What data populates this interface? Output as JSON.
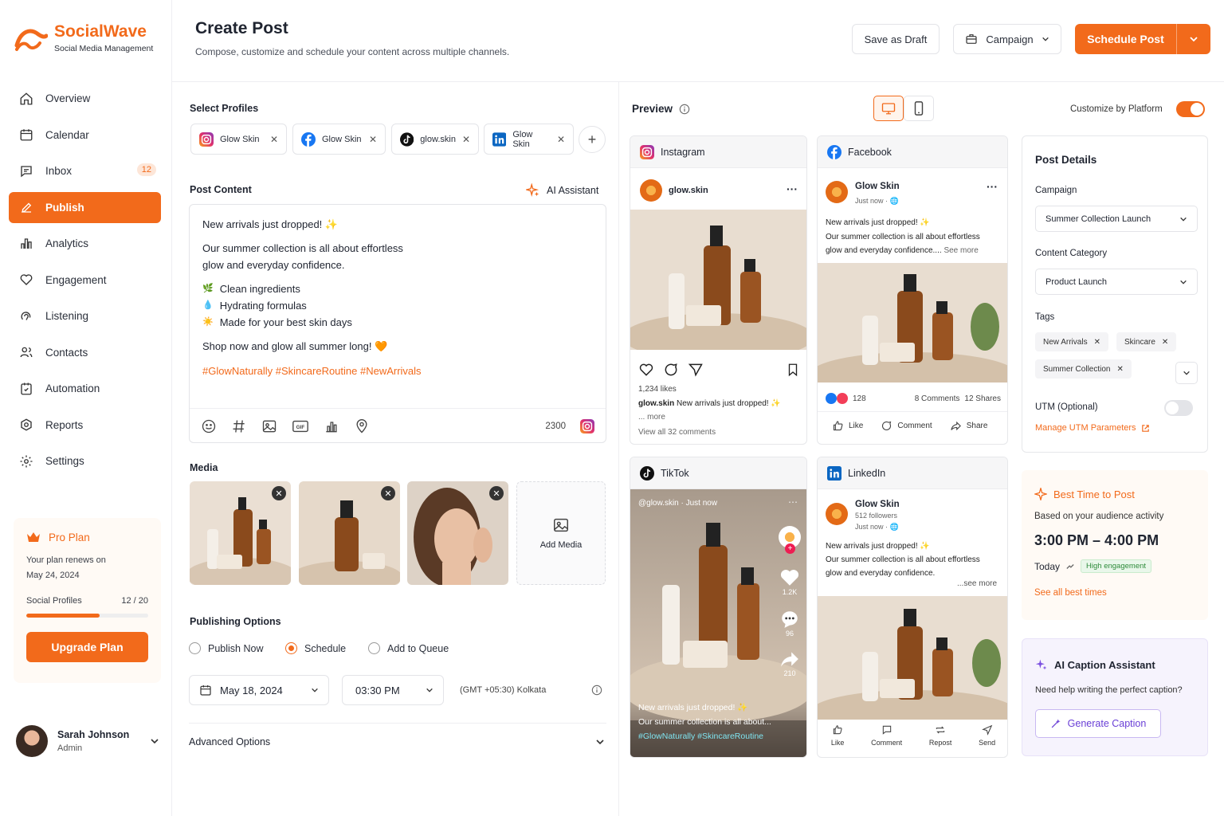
{
  "brand": {
    "name": "SocialWave",
    "tagline": "Social Media Management",
    "accent": "#f26a1b"
  },
  "nav": [
    {
      "label": "Overview",
      "icon": "home-icon"
    },
    {
      "label": "Calendar",
      "icon": "calendar-icon"
    },
    {
      "label": "Inbox",
      "icon": "inbox-icon",
      "badge": "12"
    },
    {
      "label": "Publish",
      "icon": "edit-icon",
      "active": true
    },
    {
      "label": "Analytics",
      "icon": "bar-chart-icon"
    },
    {
      "label": "Engagement",
      "icon": "heart-icon"
    },
    {
      "label": "Listening",
      "icon": "headphones-icon"
    },
    {
      "label": "Contacts",
      "icon": "users-icon"
    },
    {
      "label": "Automation",
      "icon": "automation-icon"
    },
    {
      "label": "Reports",
      "icon": "reports-icon"
    },
    {
      "label": "Settings",
      "icon": "gear-icon"
    }
  ],
  "plan": {
    "title": "Pro Plan",
    "renew_text": "Your plan renews on",
    "renew_date": "May 24, 2024",
    "profiles_label": "Social Profiles",
    "profiles_count": "12 / 20",
    "profiles_fraction": 0.6,
    "upgrade": "Upgrade Plan"
  },
  "user": {
    "name": "Sarah Johnson",
    "role": "Admin"
  },
  "header": {
    "title": "Create Post",
    "subtitle": "Compose, customize and schedule your content across multiple channels.",
    "save_draft": "Save as Draft",
    "campaign": "Campaign",
    "schedule": "Schedule Post"
  },
  "profiles": {
    "label": "Select Profiles",
    "items": [
      {
        "name": "Glow Skin",
        "network": "instagram"
      },
      {
        "name": "Glow Skin",
        "network": "facebook"
      },
      {
        "name": "glow.skin",
        "network": "tiktok"
      },
      {
        "name": "Glow Skin",
        "network": "linkedin"
      }
    ]
  },
  "content": {
    "label": "Post Content",
    "ai": "AI Assistant",
    "line1": "New arrivals just dropped! ✨",
    "line2": "Our summer collection is all about effortless",
    "line3": "glow and everyday confidence.",
    "bullets": [
      {
        "icon": "🌿",
        "text": "Clean ingredients"
      },
      {
        "icon": "💧",
        "text": "Hydrating formulas"
      },
      {
        "icon": "☀️",
        "text": "Made for your best skin days"
      }
    ],
    "line4": "Shop now and glow all summer long! 🧡",
    "hashtags": "#GlowNaturally #SkincareRoutine #NewArrivals",
    "char_count": "2300"
  },
  "media": {
    "label": "Media",
    "add": "Add Media"
  },
  "publishing": {
    "label": "Publishing Options",
    "options": [
      "Publish Now",
      "Schedule",
      "Add to Queue"
    ],
    "selected": "Schedule",
    "date": "May 18, 2024",
    "time": "03:30 PM",
    "timezone": "(GMT +05:30) Kolkata"
  },
  "advanced": "Advanced Options",
  "preview": {
    "label": "Preview",
    "customize": "Customize by Platform"
  },
  "instagram": {
    "title": "Instagram",
    "user": "glow.skin",
    "likes": "1,234 likes",
    "caption_user": "glow.skin",
    "caption": "New arrivals just dropped! ✨",
    "more": "... more",
    "comments": "View all 32 comments"
  },
  "facebook": {
    "title": "Facebook",
    "user": "Glow Skin",
    "time": "Just now · 🌐",
    "text1": "New arrivals just dropped! ✨",
    "text2": "Our summer collection is all about effortless",
    "text3": "glow and everyday confidence....",
    "see_more": "See more",
    "reactions": "128",
    "comments": "8 Comments",
    "shares": "12 Shares",
    "actions": [
      "Like",
      "Comment",
      "Share"
    ]
  },
  "tiktok": {
    "title": "TikTok",
    "handle": "@glow.skin · Just now",
    "likes": "1.2K",
    "comments": "96",
    "shares": "210",
    "text1": "New arrivals just dropped! ✨",
    "text2": "Our summer collection is all about...",
    "tags": "#GlowNaturally #SkincareRoutine"
  },
  "linkedin": {
    "title": "LinkedIn",
    "user": "Glow Skin",
    "followers": "512 followers",
    "time": "Just now · 🌐",
    "text1": "New arrivals just dropped! ✨",
    "text2": "Our summer collection is all about effortless",
    "text3": "glow and everyday confidence.",
    "see_more": "...see more",
    "actions": [
      "Like",
      "Comment",
      "Repost",
      "Send"
    ]
  },
  "details": {
    "title": "Post Details",
    "campaign_label": "Campaign",
    "campaign": "Summer Collection Launch",
    "category_label": "Content Category",
    "category": "Product Launch",
    "tags_label": "Tags",
    "tags": [
      "New Arrivals",
      "Skincare",
      "Summer Collection"
    ],
    "utm_label": "UTM (Optional)",
    "utm_link": "Manage UTM Parameters"
  },
  "best_time": {
    "title": "Best Time to Post",
    "sub": "Based on your audience activity",
    "range": "3:00 PM – 4:00 PM",
    "day": "Today",
    "badge": "High engagement",
    "link": "See all best times"
  },
  "ai_caption": {
    "title": "AI Caption Assistant",
    "sub": "Need help writing the perfect caption?",
    "button": "Generate Caption"
  }
}
